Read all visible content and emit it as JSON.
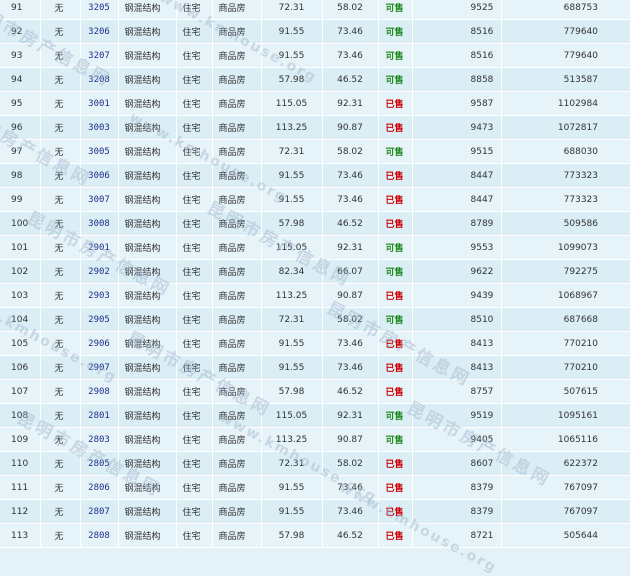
{
  "table": {
    "rows": [
      {
        "no": "91",
        "floor": "无",
        "room": "3205",
        "structure": "钢混结构",
        "use": "住宅",
        "type": "商品房",
        "area1": "72.31",
        "area2": "58.02",
        "status": "可售",
        "price": "9525",
        "total": "688753"
      },
      {
        "no": "92",
        "floor": "无",
        "room": "3206",
        "structure": "钢混结构",
        "use": "住宅",
        "type": "商品房",
        "area1": "91.55",
        "area2": "73.46",
        "status": "可售",
        "price": "8516",
        "total": "779640"
      },
      {
        "no": "93",
        "floor": "无",
        "room": "3207",
        "structure": "钢混结构",
        "use": "住宅",
        "type": "商品房",
        "area1": "91.55",
        "area2": "73.46",
        "status": "可售",
        "price": "8516",
        "total": "779640"
      },
      {
        "no": "94",
        "floor": "无",
        "room": "3208",
        "structure": "钢混结构",
        "use": "住宅",
        "type": "商品房",
        "area1": "57.98",
        "area2": "46.52",
        "status": "可售",
        "price": "8858",
        "total": "513587"
      },
      {
        "no": "95",
        "floor": "无",
        "room": "3001",
        "structure": "钢混结构",
        "use": "住宅",
        "type": "商品房",
        "area1": "115.05",
        "area2": "92.31",
        "status": "已售",
        "price": "9587",
        "total": "1102984"
      },
      {
        "no": "96",
        "floor": "无",
        "room": "3003",
        "structure": "钢混结构",
        "use": "住宅",
        "type": "商品房",
        "area1": "113.25",
        "area2": "90.87",
        "status": "已售",
        "price": "9473",
        "total": "1072817"
      },
      {
        "no": "97",
        "floor": "无",
        "room": "3005",
        "structure": "钢混结构",
        "use": "住宅",
        "type": "商品房",
        "area1": "72.31",
        "area2": "58.02",
        "status": "可售",
        "price": "9515",
        "total": "688030"
      },
      {
        "no": "98",
        "floor": "无",
        "room": "3006",
        "structure": "钢混结构",
        "use": "住宅",
        "type": "商品房",
        "area1": "91.55",
        "area2": "73.46",
        "status": "已售",
        "price": "8447",
        "total": "773323"
      },
      {
        "no": "99",
        "floor": "无",
        "room": "3007",
        "structure": "钢混结构",
        "use": "住宅",
        "type": "商品房",
        "area1": "91.55",
        "area2": "73.46",
        "status": "已售",
        "price": "8447",
        "total": "773323"
      },
      {
        "no": "100",
        "floor": "无",
        "room": "3008",
        "structure": "钢混结构",
        "use": "住宅",
        "type": "商品房",
        "area1": "57.98",
        "area2": "46.52",
        "status": "已售",
        "price": "8789",
        "total": "509586"
      },
      {
        "no": "101",
        "floor": "无",
        "room": "2901",
        "structure": "钢混结构",
        "use": "住宅",
        "type": "商品房",
        "area1": "115.05",
        "area2": "92.31",
        "status": "可售",
        "price": "9553",
        "total": "1099073"
      },
      {
        "no": "102",
        "floor": "无",
        "room": "2902",
        "structure": "钢混结构",
        "use": "住宅",
        "type": "商品房",
        "area1": "82.34",
        "area2": "66.07",
        "status": "可售",
        "price": "9622",
        "total": "792275"
      },
      {
        "no": "103",
        "floor": "无",
        "room": "2903",
        "structure": "钢混结构",
        "use": "住宅",
        "type": "商品房",
        "area1": "113.25",
        "area2": "90.87",
        "status": "已售",
        "price": "9439",
        "total": "1068967"
      },
      {
        "no": "104",
        "floor": "无",
        "room": "2905",
        "structure": "钢混结构",
        "use": "住宅",
        "type": "商品房",
        "area1": "72.31",
        "area2": "58.02",
        "status": "可售",
        "price": "8510",
        "total": "687668"
      },
      {
        "no": "105",
        "floor": "无",
        "room": "2906",
        "structure": "钢混结构",
        "use": "住宅",
        "type": "商品房",
        "area1": "91.55",
        "area2": "73.46",
        "status": "已售",
        "price": "8413",
        "total": "770210"
      },
      {
        "no": "106",
        "floor": "无",
        "room": "2907",
        "structure": "钢混结构",
        "use": "住宅",
        "type": "商品房",
        "area1": "91.55",
        "area2": "73.46",
        "status": "已售",
        "price": "8413",
        "total": "770210"
      },
      {
        "no": "107",
        "floor": "无",
        "room": "2908",
        "structure": "钢混结构",
        "use": "住宅",
        "type": "商品房",
        "area1": "57.98",
        "area2": "46.52",
        "status": "已售",
        "price": "8757",
        "total": "507615"
      },
      {
        "no": "108",
        "floor": "无",
        "room": "2801",
        "structure": "钢混结构",
        "use": "住宅",
        "type": "商品房",
        "area1": "115.05",
        "area2": "92.31",
        "status": "可售",
        "price": "9519",
        "total": "1095161"
      },
      {
        "no": "109",
        "floor": "无",
        "room": "2803",
        "structure": "钢混结构",
        "use": "住宅",
        "type": "商品房",
        "area1": "113.25",
        "area2": "90.87",
        "status": "可售",
        "price": "9405",
        "total": "1065116"
      },
      {
        "no": "110",
        "floor": "无",
        "room": "2805",
        "structure": "钢混结构",
        "use": "住宅",
        "type": "商品房",
        "area1": "72.31",
        "area2": "58.02",
        "status": "已售",
        "price": "8607",
        "total": "622372"
      },
      {
        "no": "111",
        "floor": "无",
        "room": "2806",
        "structure": "钢混结构",
        "use": "住宅",
        "type": "商品房",
        "area1": "91.55",
        "area2": "73.46",
        "status": "已售",
        "price": "8379",
        "total": "767097"
      },
      {
        "no": "112",
        "floor": "无",
        "room": "2807",
        "structure": "钢混结构",
        "use": "住宅",
        "type": "商品房",
        "area1": "91.55",
        "area2": "73.46",
        "status": "已售",
        "price": "8379",
        "total": "767097"
      },
      {
        "no": "113",
        "floor": "无",
        "room": "2808",
        "structure": "钢混结构",
        "use": "住宅",
        "type": "商品房",
        "area1": "57.98",
        "area2": "46.52",
        "status": "已售",
        "price": "8721",
        "total": "505644"
      }
    ]
  },
  "status_colors": {
    "已售": "#cc0000",
    "可售": "#1d8a1d"
  },
  "watermark": {
    "cn": "昆明市房产信息网",
    "en": "www.kmhouse.org"
  }
}
